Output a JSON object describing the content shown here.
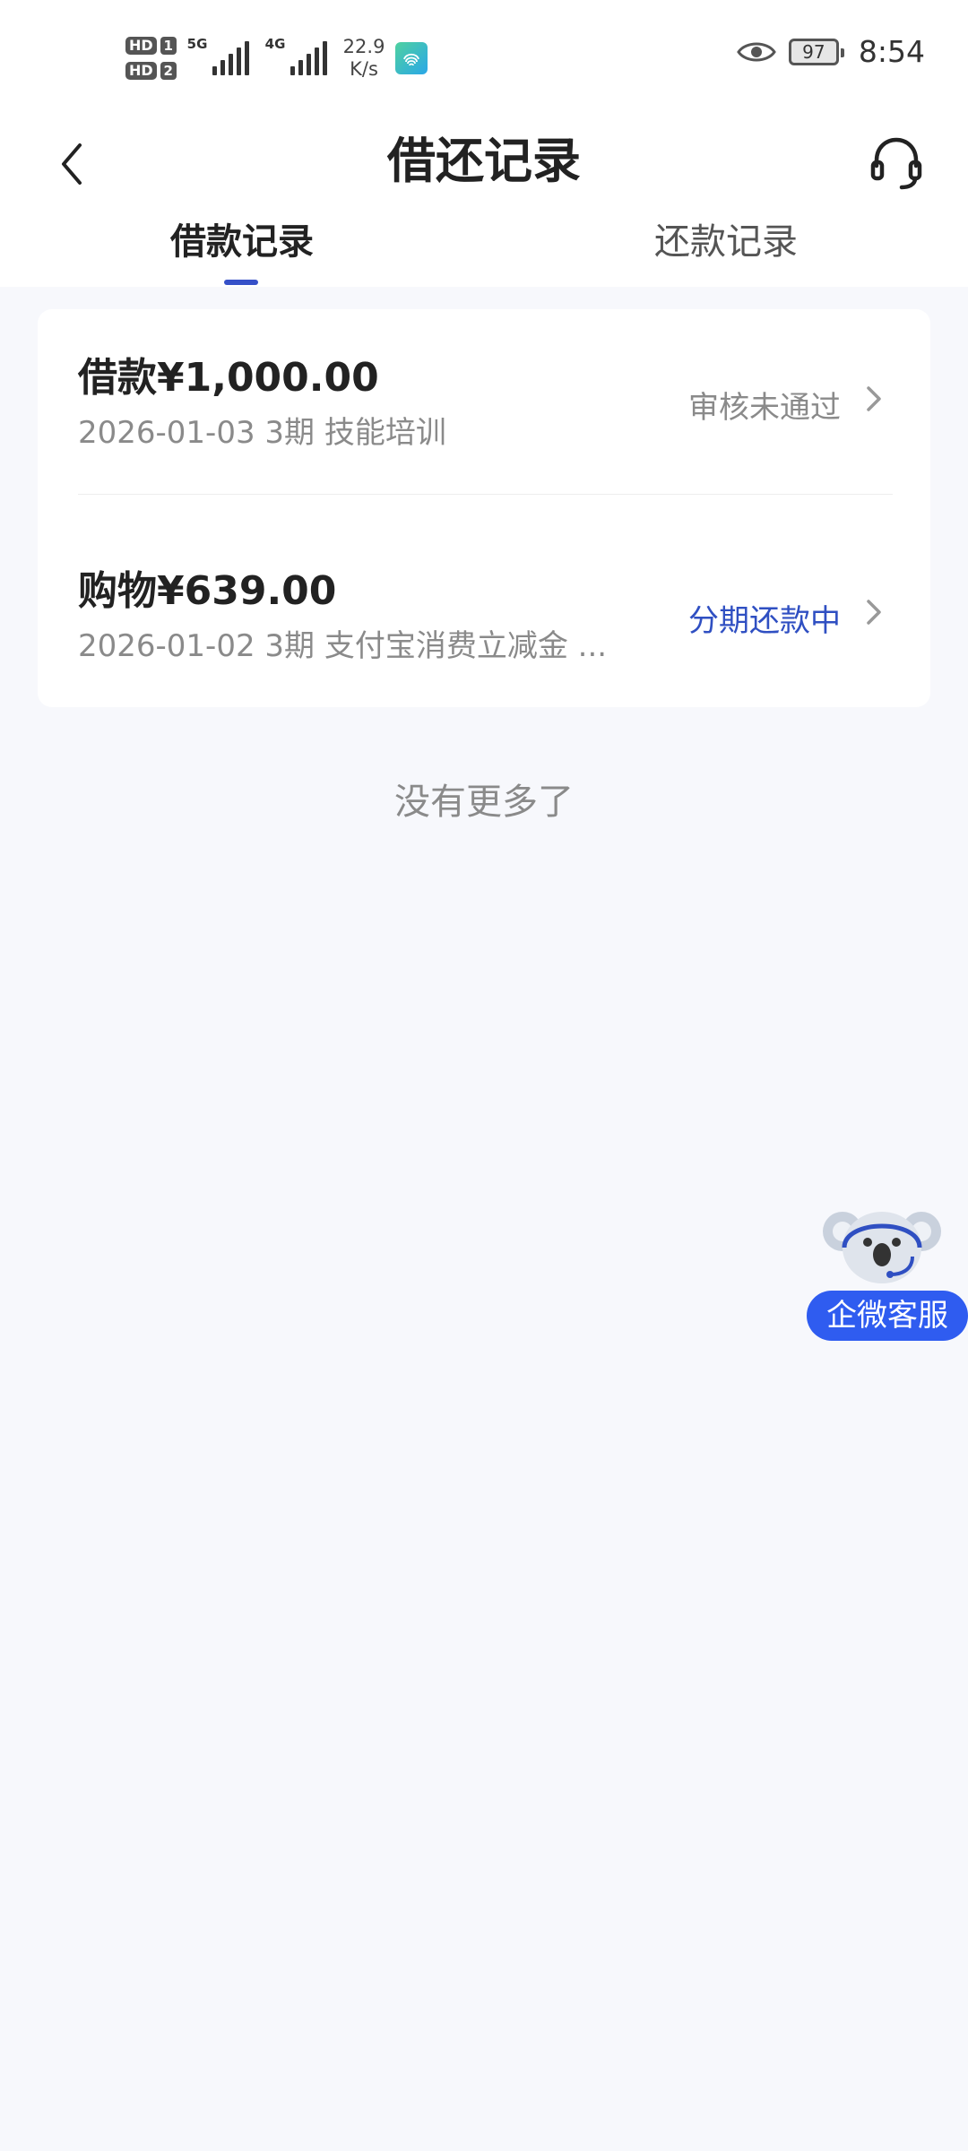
{
  "status_bar": {
    "hd1": "HD",
    "hd1_num": "1",
    "hd2": "HD",
    "hd2_num": "2",
    "sim1_network": "5G",
    "sim2_network": "4G",
    "speed_value": "22.9",
    "speed_unit": "K/s",
    "battery": "97",
    "time": "8:54"
  },
  "nav": {
    "title": "借还记录"
  },
  "tabs": [
    {
      "label": "借款记录",
      "active": true
    },
    {
      "label": "还款记录",
      "active": false
    }
  ],
  "records": [
    {
      "title": "借款¥1,000.00",
      "subtitle": "2026-01-03 3期  技能培训",
      "status": "审核未通过",
      "status_color": "#8a8a8a"
    },
    {
      "title": "购物¥639.00",
      "subtitle": "2026-01-02 3期  支付宝消费立减金 ...",
      "status": "分期还款中",
      "status_color": "#2f4fc2"
    }
  ],
  "list_end_text": "没有更多了",
  "floating_service": {
    "label": "企微客服"
  },
  "colors": {
    "accent": "#3550c8",
    "service_button": "#2f5cf0",
    "background": "#f7f8fc"
  }
}
